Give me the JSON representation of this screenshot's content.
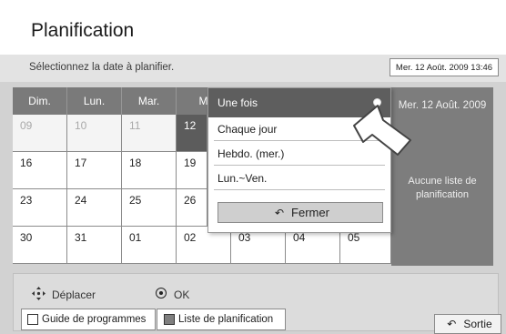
{
  "title": "Planification",
  "instruction": "Sélectionnez la date à planifier.",
  "current_datetime": "Mer. 12 Août. 2009 13:46",
  "calendar": {
    "weekdays": [
      "Dim.",
      "Lun.",
      "Mar.",
      "M"
    ],
    "rows": [
      [
        "09",
        "10",
        "11",
        "12"
      ],
      [
        "16",
        "17",
        "18",
        "19"
      ],
      [
        "23",
        "24",
        "25",
        "26"
      ],
      [
        "30",
        "31",
        "01",
        "02",
        "03",
        "04",
        "05"
      ]
    ]
  },
  "side_panel": {
    "date": "Mer. 12 Août. 2009",
    "empty_text": "Aucune liste de planification"
  },
  "popup": {
    "options": [
      "Une fois",
      "Chaque jour",
      "Hebdo. (mer.)",
      "Lun.~Ven."
    ],
    "close_label": "Fermer"
  },
  "footer": {
    "move_label": "Déplacer",
    "ok_label": "OK",
    "tab_guide": "Guide de programmes",
    "tab_schedule": "Liste de planification",
    "exit_label": "Sortie"
  },
  "colors": {
    "header_bg": "#ffffff",
    "selected_bg": "#5e5e5e",
    "panel_bg": "#7d7d7d",
    "screen_bg": "#d2d2d2"
  },
  "icons": [
    "move-icon",
    "ok-radio-icon",
    "back-arrow-icon",
    "pointer-cursor-icon"
  ]
}
